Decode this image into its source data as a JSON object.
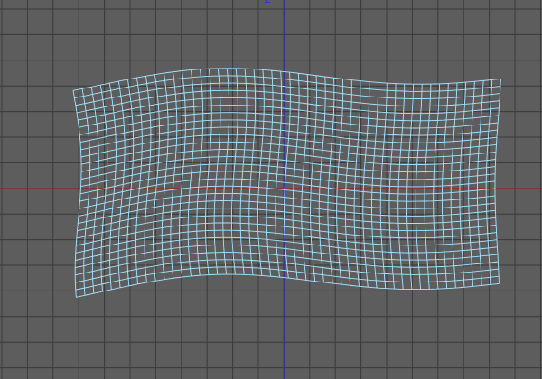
{
  "viewport": {
    "background_color": "#5d5d5d",
    "grid_color": "#3a3a3a"
  },
  "axes": {
    "x_axis_color": "#b42323",
    "y_axis_color": "#2a2ad6",
    "y_label": "Z"
  },
  "mesh": {
    "color": "#a8e4ff",
    "rows": 28,
    "cols": 48
  }
}
